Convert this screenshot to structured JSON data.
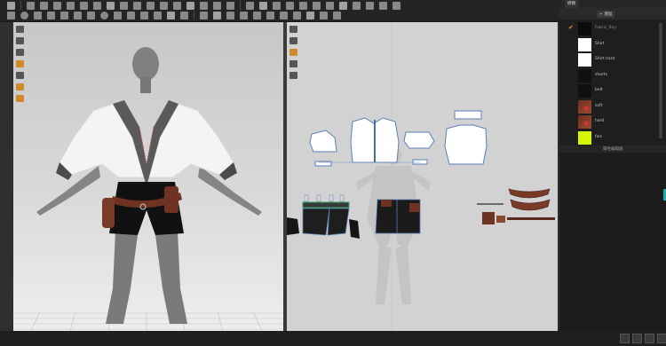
{
  "object_browser": {
    "tabs": [
      "",
      "织物",
      "",
      "",
      ""
    ],
    "add_button": "+ 增加",
    "fabrics": [
      {
        "name": "Fabric_Boy",
        "color": "#0c0c0c",
        "selected": true,
        "pattern": "solid"
      },
      {
        "name": "Shirt",
        "color": "#ffffff",
        "selected": false,
        "pattern": "solid"
      },
      {
        "name": "Shirt hard",
        "color": "#ffffff",
        "selected": false,
        "pattern": "solid"
      },
      {
        "name": "shorts",
        "color": "#111111",
        "selected": false,
        "pattern": "solid"
      },
      {
        "name": "belt",
        "color": "#101010",
        "selected": false,
        "pattern": "solid"
      },
      {
        "name": "soft",
        "color": "#7b3a28",
        "selected": false,
        "pattern": "leather"
      },
      {
        "name": "hard",
        "color": "#7b3a28",
        "selected": false,
        "pattern": "leather"
      },
      {
        "name": "fals",
        "color": "#d6f500",
        "selected": false,
        "pattern": "solid"
      }
    ]
  },
  "property_editor": {
    "title": "属性编辑器"
  },
  "colors": {
    "accent": "#e6a400",
    "teal": "#18b0b0",
    "pattern_outline": "#5a7fb4",
    "topstitch": "#d04040"
  }
}
